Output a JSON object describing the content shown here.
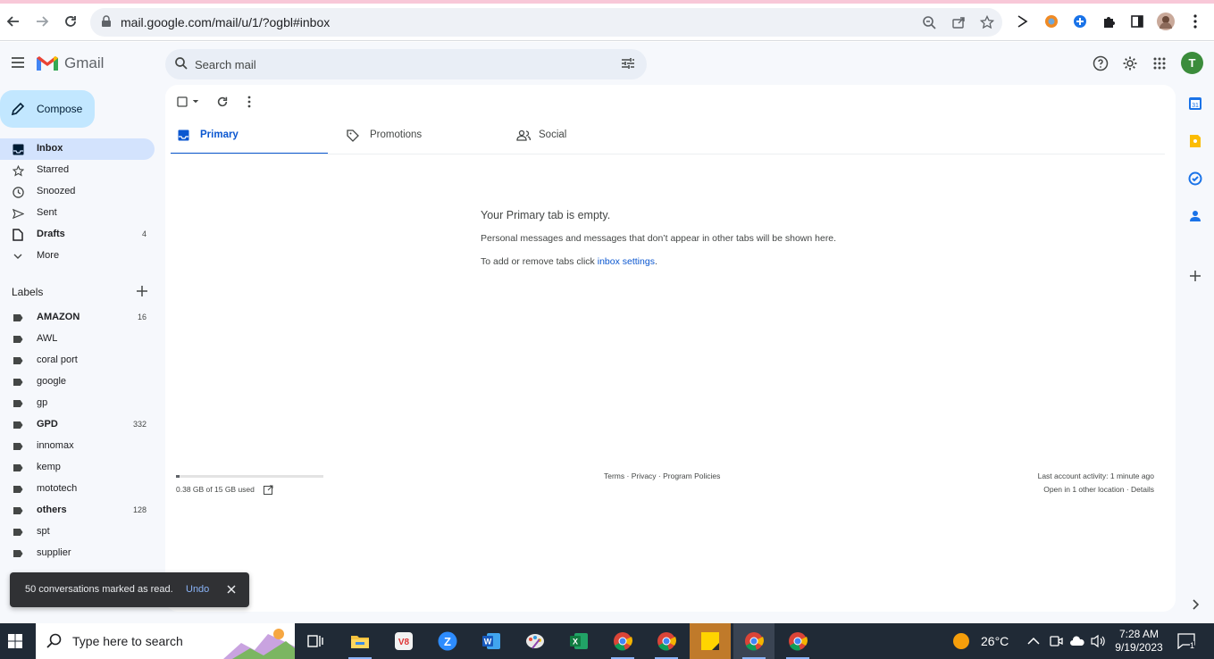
{
  "browser": {
    "url": "mail.google.com/mail/u/1/?ogbl#inbox"
  },
  "app": {
    "name": "Gmail"
  },
  "search": {
    "placeholder": "Search mail"
  },
  "avatar_letter": "T",
  "compose_label": "Compose",
  "nav": [
    {
      "label": "Inbox",
      "count": "",
      "icon": "inbox-icon"
    },
    {
      "label": "Starred",
      "count": "",
      "icon": "star-icon"
    },
    {
      "label": "Snoozed",
      "count": "",
      "icon": "clock-icon"
    },
    {
      "label": "Sent",
      "count": "",
      "icon": "send-icon"
    },
    {
      "label": "Drafts",
      "count": "4",
      "icon": "draft-icon"
    },
    {
      "label": "More",
      "count": "",
      "icon": "chevron-down-icon"
    }
  ],
  "labels": {
    "title": "Labels",
    "items": [
      {
        "label": "AMAZON",
        "count": "16"
      },
      {
        "label": "AWL",
        "count": ""
      },
      {
        "label": "coral port",
        "count": ""
      },
      {
        "label": "google",
        "count": ""
      },
      {
        "label": "gp",
        "count": ""
      },
      {
        "label": "GPD",
        "count": "332"
      },
      {
        "label": "innomax",
        "count": ""
      },
      {
        "label": "kemp",
        "count": ""
      },
      {
        "label": "mototech",
        "count": ""
      },
      {
        "label": "others",
        "count": "128"
      },
      {
        "label": "spt",
        "count": ""
      },
      {
        "label": "supplier",
        "count": ""
      }
    ]
  },
  "tabs": [
    {
      "label": "Primary",
      "icon": "inbox-tab-icon"
    },
    {
      "label": "Promotions",
      "icon": "tag-icon"
    },
    {
      "label": "Social",
      "icon": "people-icon"
    }
  ],
  "empty": {
    "title": "Your Primary tab is empty.",
    "description": "Personal messages and messages that don’t appear in other tabs will be shown here.",
    "settings_prefix": "To add or remove tabs click ",
    "settings_link": "inbox settings",
    "settings_suffix": "."
  },
  "footer": {
    "storage_text": "0.38 GB of 15 GB used",
    "storage_fraction": 0.025,
    "links": "Terms · Privacy · Program Policies",
    "last_activity": "Last account activity: 1 minute ago",
    "other_location": "Open in 1 other location · Details"
  },
  "snackbar": {
    "message": "50 conversations marked as read.",
    "undo": "Undo"
  },
  "taskbar": {
    "search_placeholder": "Type here to search",
    "temperature": "26°C",
    "time": "7:28 AM",
    "date": "9/19/2023",
    "notification_count": "1"
  },
  "colors": {
    "accent": "#0b57d0",
    "compose_bg": "#c2e7ff",
    "active_nav_bg": "#d3e3fd",
    "avatar_bg": "#3b8c3b"
  }
}
